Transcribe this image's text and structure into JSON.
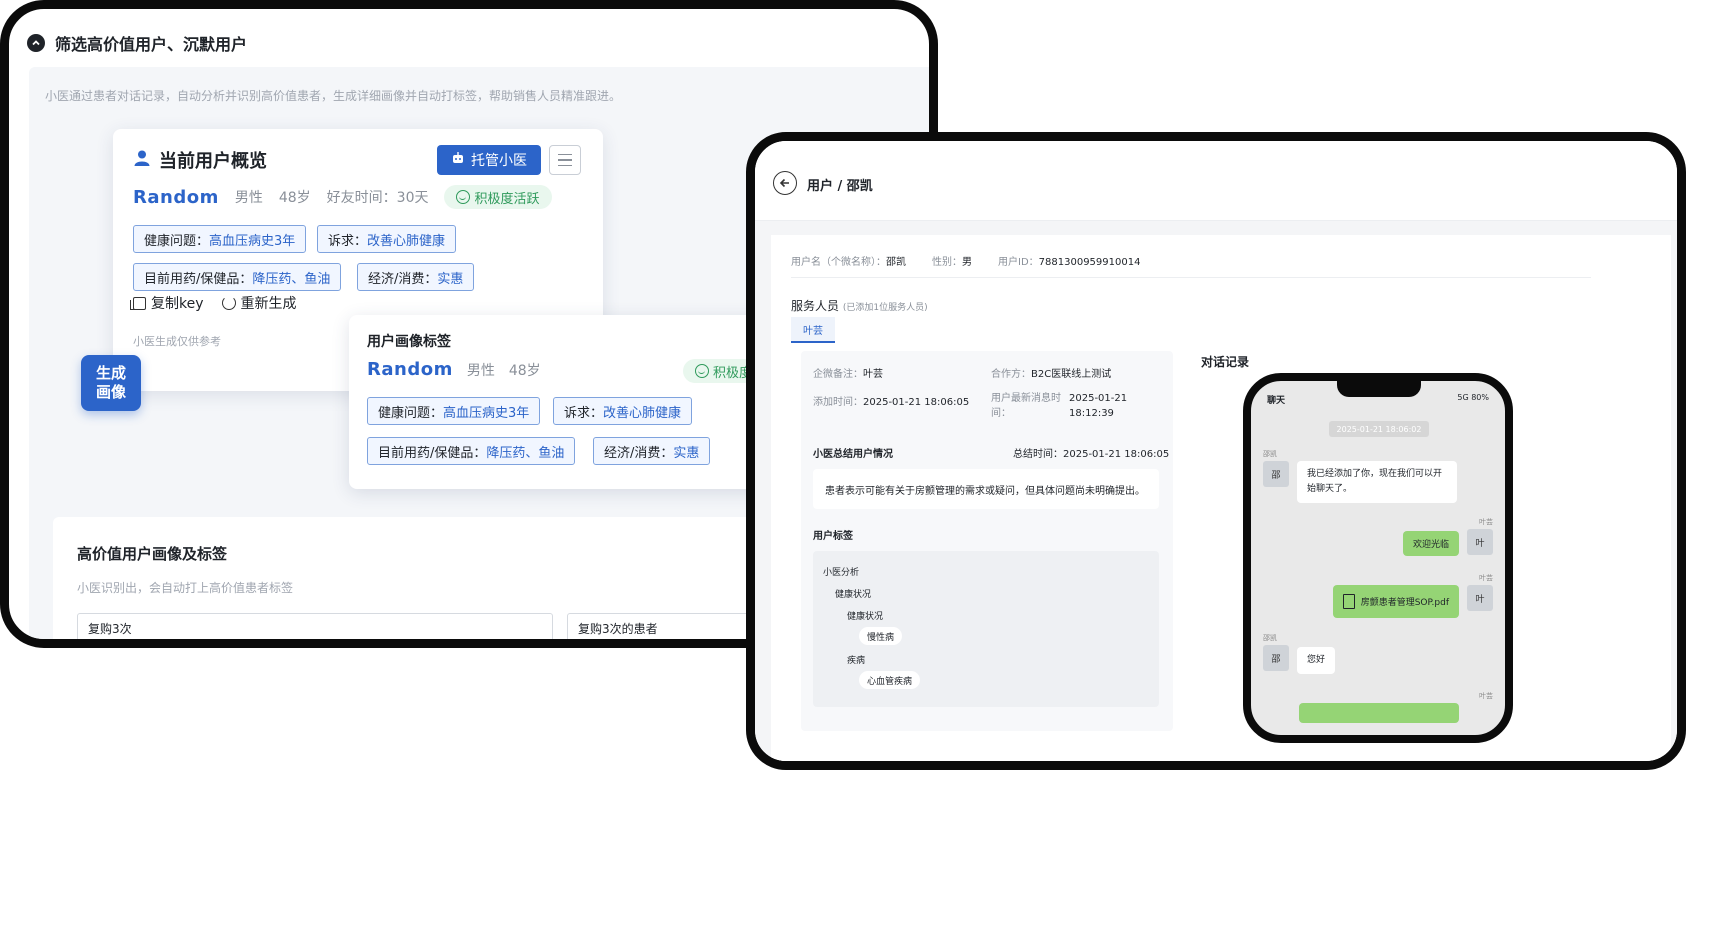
{
  "left_panel": {
    "header_title": "筛选高价值用户、沉默用户",
    "description": "小医通过患者对话记录，自动分析并识别高价值患者，生成详细画像并自动打标签，帮助销售人员精准跟进。",
    "overview": {
      "title": "当前用户概览",
      "tuoguan_label": "托管小医",
      "user_name": "Random",
      "gender": "男性",
      "age": "48岁",
      "friend_time": "好友时间：30天",
      "active_label": "积极度活跃",
      "tags": {
        "health_key": "健康问题：",
        "health_val": "高血压病史3年",
        "demand_key": "诉求：",
        "demand_val": "改善心肺健康",
        "meds_key": "目前用药/保健品：",
        "meds_val": "降压药、鱼油",
        "econ_key": "经济/消费：",
        "econ_val": "实惠"
      },
      "copy_key_label": "复制key",
      "regenerate_label": "重新生成",
      "footnote": "小医生成仅供参考"
    },
    "generate_button": "生成画像",
    "profile_card": {
      "title": "用户画像标签",
      "user_name": "Random",
      "gender": "男性",
      "age": "48岁",
      "active_label": "积极度",
      "tags": {
        "health_key": "健康问题：",
        "health_val": "高血压病史3年",
        "demand_key": "诉求：",
        "demand_val": "改善心肺健康",
        "meds_key": "目前用药/保健品：",
        "meds_val": "降压药、鱼油",
        "econ_key": "经济/消费：",
        "econ_val": "实惠"
      }
    },
    "high_value": {
      "title": "高价值用户画像及标签",
      "subtitle": "小医识别出，会自动打上高价值患者标签",
      "input_1": "复购3次",
      "input_2": "复购3次的患者"
    }
  },
  "right_panel": {
    "breadcrumb": "用户 / 邵凯",
    "info": {
      "username_label": "用户名（个微名称）：",
      "username": "邵凯",
      "gender_label": "性别：",
      "gender": "男",
      "userid_label": "用户ID：",
      "userid": "7881300959910014"
    },
    "staff_title": "服务人员",
    "staff_note": "(已添加1位服务人员)",
    "staff_tab": "叶芸",
    "summary": {
      "remark_label": "企微备注：",
      "remark": "叶芸",
      "partner_label": "合作方：",
      "partner": "B2C医联线上测试",
      "added_label": "添加时间：",
      "added": "2025-01-21 18:06:05",
      "latest_label_1": "用户最新消息时",
      "latest_label_2": "间：",
      "latest_1": "2025-01-21",
      "latest_2": "18:12:39",
      "summary_head": "小医总结用户情况",
      "summary_time_label": "总结时间：",
      "summary_time": "2025-01-21 18:06:05",
      "summary_text": "患者表示可能有关于房颤管理的需求或疑问，但具体问题尚未明确提出。",
      "tags_head": "用户标签",
      "tree": {
        "root": "小医分析",
        "l1": "健康状况",
        "l2": "健康状况",
        "l3": "慢性病",
        "l4": "疾病",
        "l5": "心血管疾病"
      }
    },
    "chat_title": "对话记录",
    "phone": {
      "status_left": "聊天",
      "status_right": "5G  80%",
      "time_stamp": "2025-01-21 18:06:02",
      "name_user": "邵凯",
      "avatar_user": "邵",
      "msg_1": "我已经添加了你，现在我们可以开始聊天了。",
      "name_staff": "叶芸",
      "avatar_staff": "叶",
      "msg_2": "欢迎光临",
      "msg_3": "房颤患者管理SOP.pdf",
      "msg_4": "您好"
    }
  }
}
